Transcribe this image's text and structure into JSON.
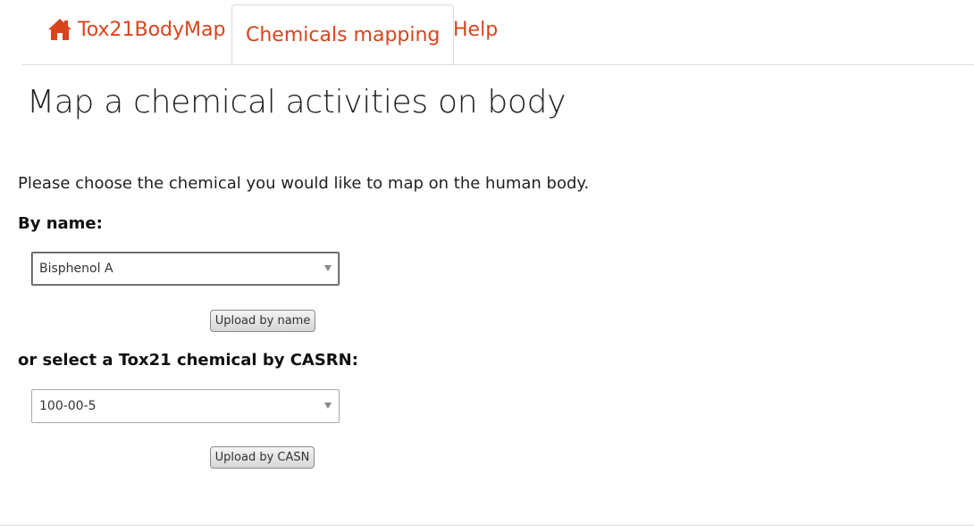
{
  "nav": {
    "home_label": "Tox21BodyMap",
    "tabs": [
      {
        "label": "Chemicals mapping",
        "active": true
      },
      {
        "label": "Help",
        "active": false
      }
    ],
    "accent_color": "#d9441c"
  },
  "page_title": "Map a chemical activities on body",
  "intro_text": "Please choose the chemical you would like to map on the human body.",
  "by_name": {
    "label": "By name:",
    "selected_value": "Bisphenol A",
    "button_label": "Upload by name"
  },
  "by_cas": {
    "label": "or select a Tox21 chemical by CASRN:",
    "selected_value": "100-00-5",
    "button_label": "Upload by CASN"
  }
}
